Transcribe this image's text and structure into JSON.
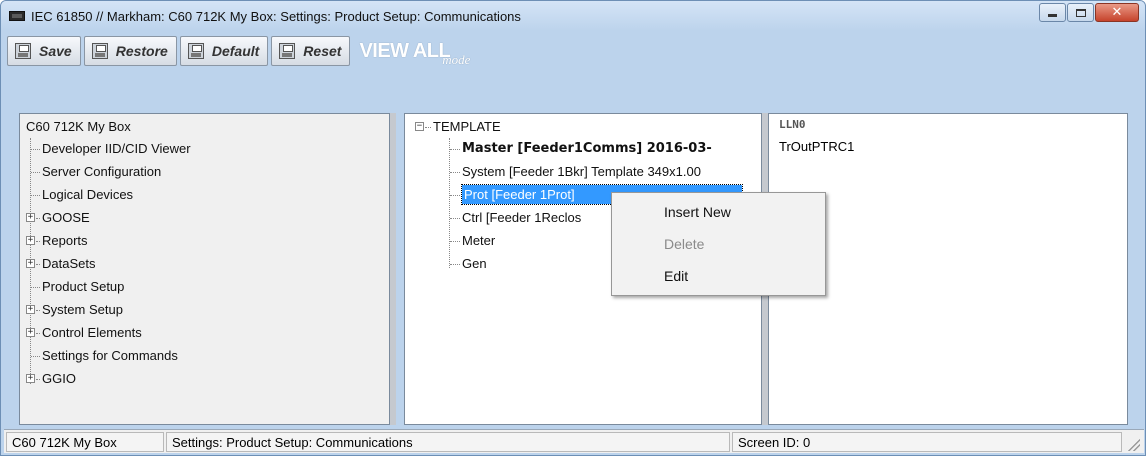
{
  "window": {
    "title": "IEC 61850 // Markham: C60 712K My Box: Settings: Product Setup: Communications",
    "controls": {
      "minimize_icon": "minimize-icon",
      "maximize_icon": "maximize-icon",
      "close_icon": "close-icon",
      "close_glyph": "✕"
    }
  },
  "toolbar": {
    "save_label": "Save",
    "restore_label": "Restore",
    "default_label": "Default",
    "reset_label": "Reset",
    "view_all_main": "VIEW ALL",
    "view_all_mode": "mode"
  },
  "left_tree": {
    "root": "C60 712K My Box",
    "items": [
      {
        "label": "Developer IID/CID Viewer",
        "expandable": false
      },
      {
        "label": "Server Configuration",
        "expandable": false
      },
      {
        "label": "Logical Devices",
        "expandable": false
      },
      {
        "label": "GOOSE",
        "expandable": true
      },
      {
        "label": "Reports",
        "expandable": true
      },
      {
        "label": "DataSets",
        "expandable": true
      },
      {
        "label": "Product Setup",
        "expandable": false
      },
      {
        "label": "System Setup",
        "expandable": true
      },
      {
        "label": "Control Elements",
        "expandable": true
      },
      {
        "label": "Settings for Commands",
        "expandable": false
      },
      {
        "label": "GGIO",
        "expandable": true
      }
    ]
  },
  "mid_tree": {
    "root": "TEMPLATE",
    "root_expander": "−",
    "items": [
      {
        "label": "Master  [Feeder1Comms] 2016-03-",
        "bold": true
      },
      {
        "label": "System  [Feeder 1Bkr] Template 349x1.00"
      },
      {
        "label": "Prot  [Feeder 1Prot]",
        "selected": true
      },
      {
        "label": "Ctrl  [Feeder 1Reclos"
      },
      {
        "label": "Meter"
      },
      {
        "label": "Gen"
      }
    ]
  },
  "right_panel": {
    "header": "LLN0",
    "items": [
      "TrOutPTRC1"
    ]
  },
  "context_menu": {
    "insert_new": "Insert New",
    "delete": "Delete",
    "edit": "Edit"
  },
  "statusbar": {
    "device": "C60 712K My Box",
    "path": "Settings: Product Setup: Communications",
    "screen_id": "Screen ID: 0"
  },
  "colors": {
    "window_bg": "#bcd3ec",
    "selection": "#3399ff",
    "close_button": "#c6432c"
  }
}
